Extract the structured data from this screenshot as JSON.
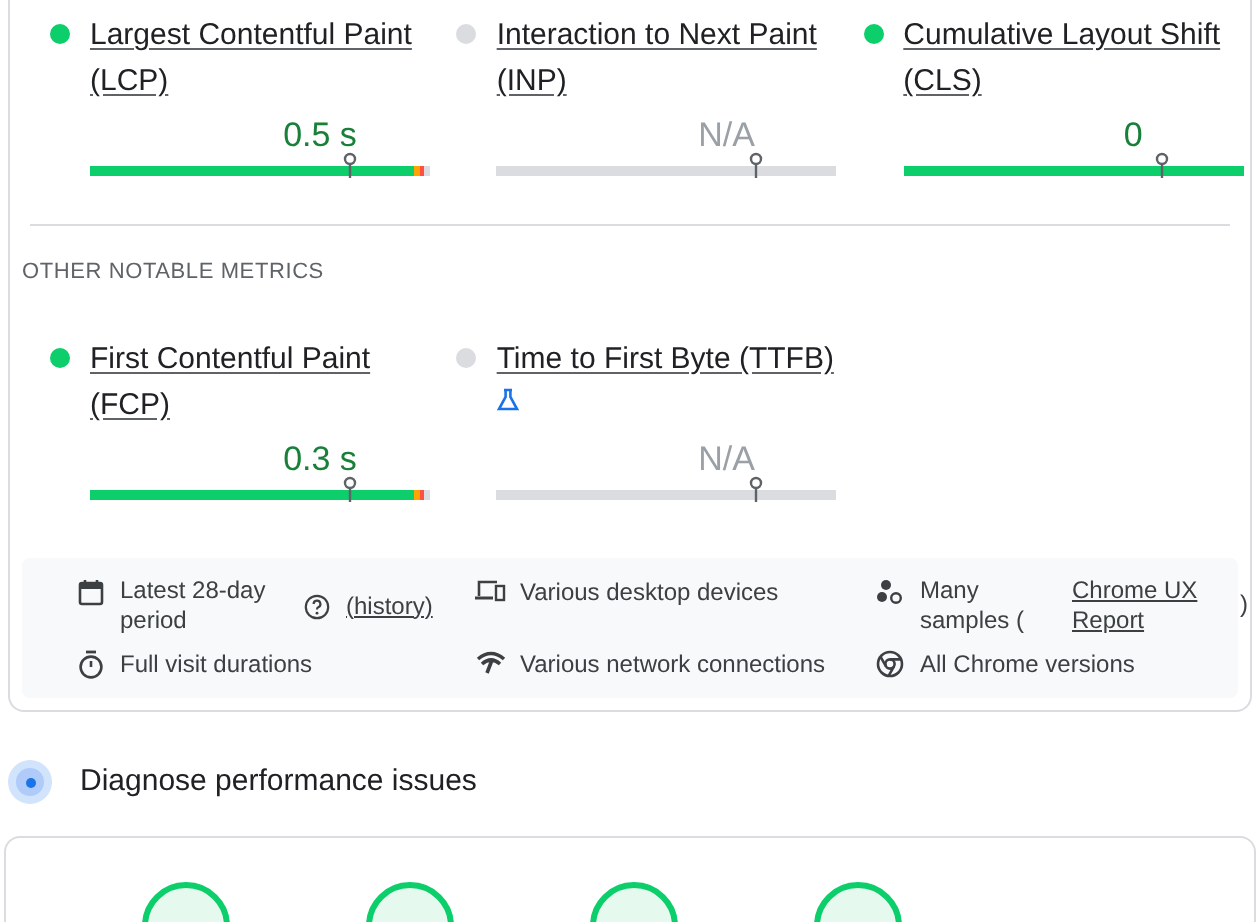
{
  "core_metrics": [
    {
      "name": "Largest Contentful Paint",
      "abbr": "(LCP)",
      "has_data": true,
      "value": "0.5 s",
      "segments": [
        {
          "kind": "good",
          "level": 0.95
        },
        {
          "kind": "needs_improvement",
          "level": 0.02
        },
        {
          "kind": "poor",
          "level": 0.01
        }
      ]
    },
    {
      "name": "Interaction to Next Paint",
      "abbr": "(INP)",
      "has_data": false,
      "value": "N/A"
    },
    {
      "name": "Cumulative Layout Shift",
      "abbr": "(CLS)",
      "has_data": true,
      "value": "0",
      "segments": [
        {
          "kind": "good",
          "level": 1
        }
      ]
    }
  ],
  "other_heading": "OTHER NOTABLE METRICS",
  "other_metrics": [
    {
      "name": "First Contentful Paint",
      "abbr": "(FCP)",
      "has_data": true,
      "value": "0.3 s",
      "segments": [
        {
          "kind": "good",
          "level": 0.95
        },
        {
          "kind": "needs_improvement",
          "level": 0.02
        },
        {
          "kind": "poor",
          "level": 0.01
        }
      ]
    },
    {
      "name": "Time to First Byte (TTFB)",
      "has_data": false,
      "value": "N/A",
      "experimental": true
    }
  ],
  "info": [
    {
      "kind": "calendar",
      "text": "Latest 28-day period",
      "link": "(history)"
    },
    {
      "kind": "devices",
      "text": "Various desktop devices"
    },
    {
      "kind": "samples",
      "text": "Many samples (",
      "link": "Chrome UX Report",
      "suffix": ")"
    },
    {
      "kind": "timer",
      "text": "Full visit durations"
    },
    {
      "kind": "network",
      "text": "Various network connections"
    },
    {
      "kind": "browser",
      "text": "All Chrome versions"
    }
  ],
  "diagnose": {
    "title": "Diagnose performance issues"
  }
}
